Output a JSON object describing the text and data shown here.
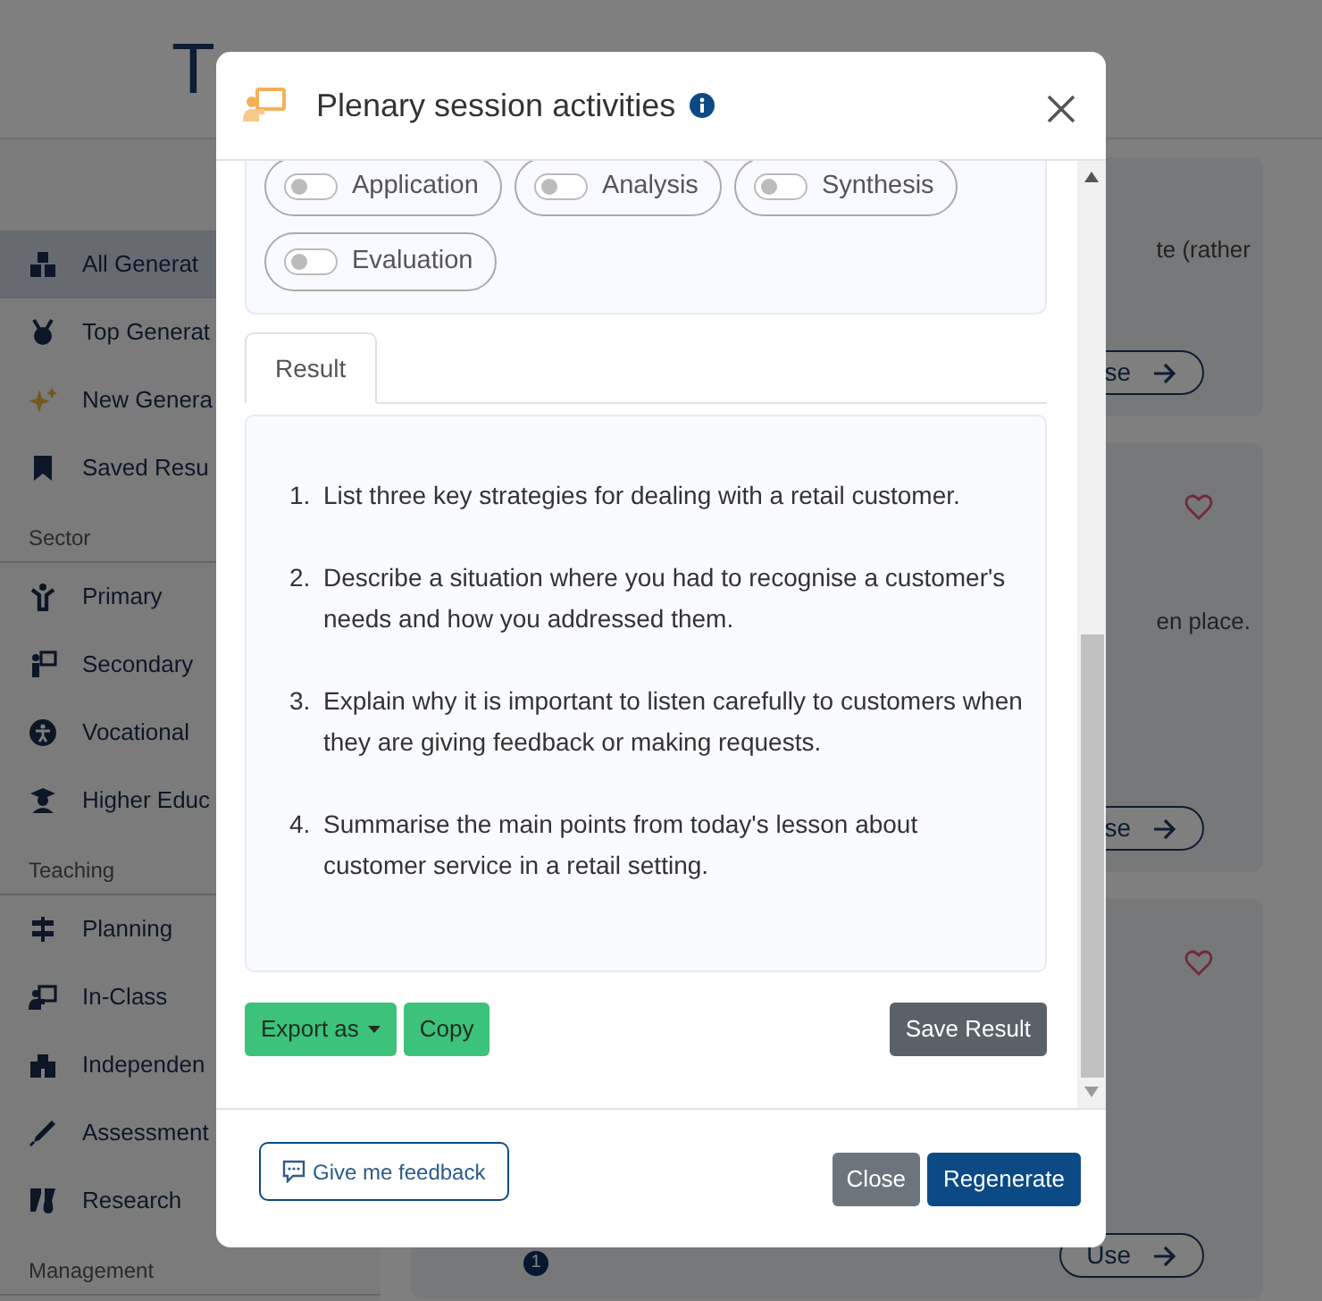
{
  "header": {
    "logo_text": "T"
  },
  "sidebar": {
    "sections": [
      {
        "items": [
          {
            "label": "All Generat",
            "selected": true
          },
          {
            "label": "Top Generat",
            "selected": false
          },
          {
            "label": "New Genera",
            "selected": false
          },
          {
            "label": "Saved Resu",
            "selected": false
          }
        ]
      },
      {
        "title": "Sector",
        "items": [
          {
            "label": "Primary",
            "selected": false
          },
          {
            "label": "Secondary",
            "selected": false
          },
          {
            "label": "Vocational",
            "selected": false
          },
          {
            "label": "Higher Educ",
            "selected": false
          }
        ]
      },
      {
        "title": "Teaching",
        "items": [
          {
            "label": "Planning",
            "selected": false
          },
          {
            "label": "In-Class",
            "selected": false
          },
          {
            "label": "Independen",
            "selected": false
          },
          {
            "label": "Assessment",
            "selected": false
          },
          {
            "label": "Research",
            "selected": false
          }
        ]
      },
      {
        "title": "Management"
      }
    ]
  },
  "cards": [
    {
      "text": "te (rather",
      "button": "se"
    },
    {
      "favorite": false,
      "text": "en place.",
      "button": "se"
    },
    {
      "favorite": false,
      "badge": "1",
      "button": "Use"
    }
  ],
  "modal": {
    "title": "Plenary session activities",
    "options": [
      {
        "label": "Application",
        "on": false
      },
      {
        "label": "Analysis",
        "on": false
      },
      {
        "label": "Synthesis",
        "on": false
      },
      {
        "label": "Evaluation",
        "on": false
      }
    ],
    "tabs": [
      {
        "label": "Result",
        "selected": true
      }
    ],
    "result": [
      {
        "number": "1.",
        "text": "List three key strategies for dealing with a retail customer."
      },
      {
        "number": "2.",
        "text": "Describe a situation where you had to recognise a customer's needs and how you addressed them."
      },
      {
        "number": "3.",
        "text": "Explain why it is important to listen carefully to customers when they are giving feedback or making requests."
      },
      {
        "number": "4.",
        "text": "Summarise the main points from today's lesson about customer service in a retail setting."
      }
    ],
    "export_button": "Export as",
    "copy_button": "Copy",
    "save_button": "Save Result",
    "feedback_button": "Give me feedback",
    "close_button": "Close",
    "regenerate_button": "Regenerate"
  }
}
